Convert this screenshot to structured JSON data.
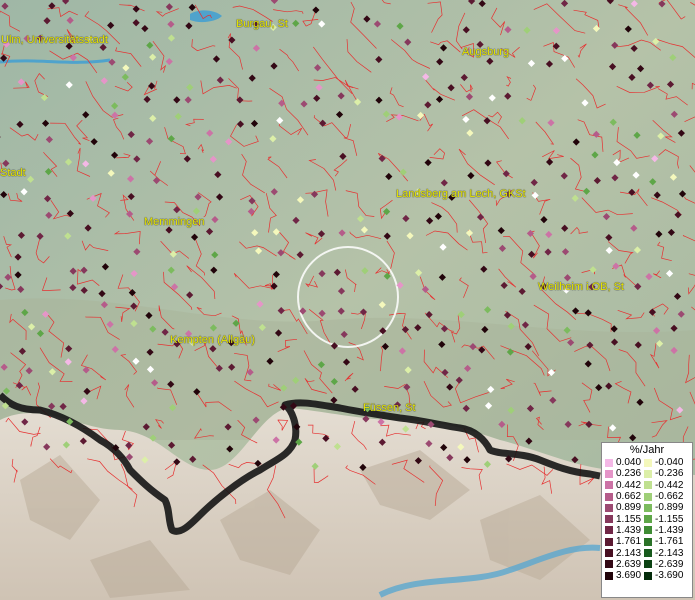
{
  "map": {
    "cities": [
      {
        "id": "ulm",
        "name": "Ulm, Universitätsstadt"
      },
      {
        "id": "burgau",
        "name": "Burgau, St"
      },
      {
        "id": "augsburg",
        "name": "Augsburg"
      },
      {
        "id": "stadt",
        "name": "Stadt"
      },
      {
        "id": "landsberg",
        "name": "Landsberg am Lech, GKSt"
      },
      {
        "id": "memmingen",
        "name": "Memmingen"
      },
      {
        "id": "weilheim",
        "name": "Weilheim i.OB, St"
      },
      {
        "id": "kempten",
        "name": "Kempten (Allgäu)"
      },
      {
        "id": "fuessen",
        "name": "Füssen, St"
      }
    ],
    "colors": {
      "boundary": "#e63030",
      "border_outline": "#111111",
      "water": "#4fa3cc",
      "terrain_low": "#a8bfa8",
      "terrain_alps": "#e6ddd0"
    }
  },
  "legend": {
    "title": "%/Jahr",
    "positive": [
      {
        "value": "0.040",
        "color": "#f4b8e6"
      },
      {
        "value": "0.236",
        "color": "#e595c8"
      },
      {
        "value": "0.442",
        "color": "#cc73a6"
      },
      {
        "value": "0.662",
        "color": "#b55c8a"
      },
      {
        "value": "0.899",
        "color": "#9c4a72"
      },
      {
        "value": "1.155",
        "color": "#86385c"
      },
      {
        "value": "1.439",
        "color": "#702646"
      },
      {
        "value": "1.761",
        "color": "#5c1a32"
      },
      {
        "value": "2.143",
        "color": "#480f22"
      },
      {
        "value": "2.639",
        "color": "#330815"
      },
      {
        "value": "3.690",
        "color": "#21040a"
      }
    ],
    "negative": [
      {
        "value": "-0.040",
        "color": "#f4f8bc"
      },
      {
        "value": "-0.236",
        "color": "#dcefa8"
      },
      {
        "value": "-0.442",
        "color": "#bfe090"
      },
      {
        "value": "-0.662",
        "color": "#9fcf78"
      },
      {
        "value": "-0.899",
        "color": "#7cbb5e"
      },
      {
        "value": "-1.155",
        "color": "#5ea648"
      },
      {
        "value": "-1.439",
        "color": "#3f8c34"
      },
      {
        "value": "-1.761",
        "color": "#2a7227"
      },
      {
        "value": "-2.143",
        "color": "#175a1c"
      },
      {
        "value": "-2.639",
        "color": "#0b4313"
      },
      {
        "value": "-3.690",
        "color": "#042c0b"
      }
    ]
  }
}
